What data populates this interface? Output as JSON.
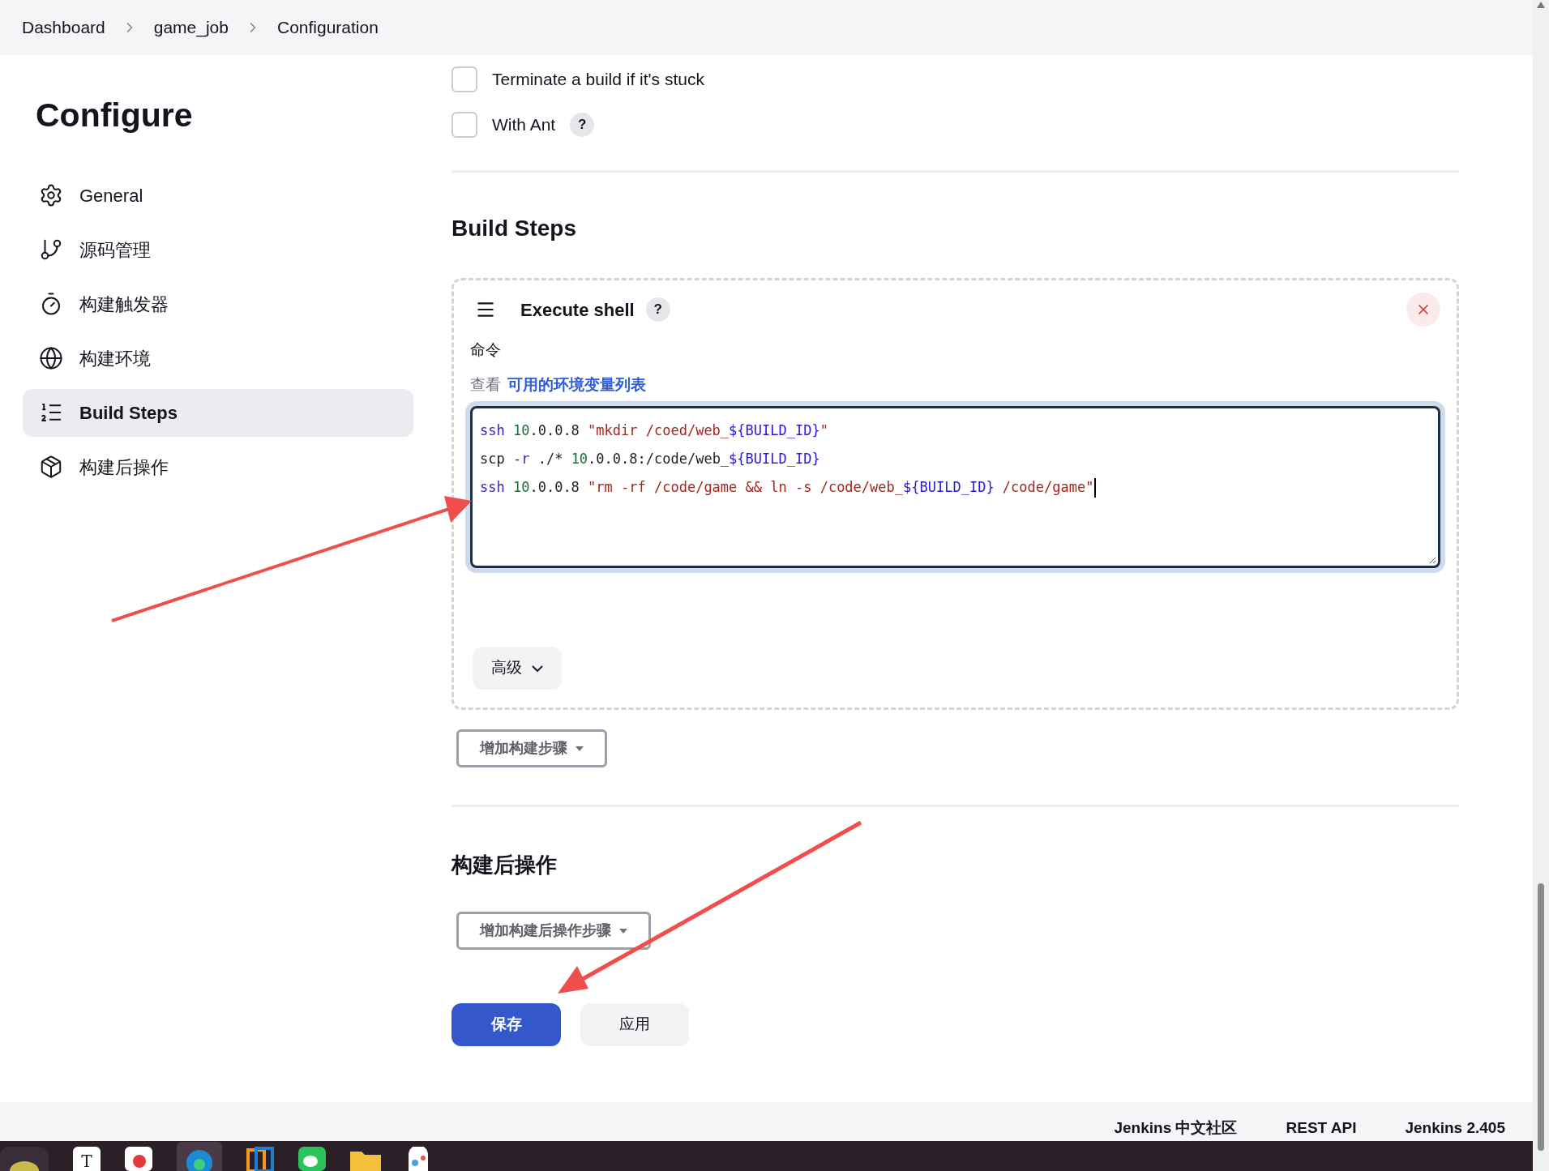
{
  "breadcrumbs": [
    "Dashboard",
    "game_job",
    "Configuration"
  ],
  "sidebar": {
    "title": "Configure",
    "items": [
      {
        "label": "General",
        "selected": false
      },
      {
        "label": "源码管理",
        "selected": false
      },
      {
        "label": "构建触发器",
        "selected": false
      },
      {
        "label": "构建环境",
        "selected": false
      },
      {
        "label": "Build Steps",
        "selected": true
      },
      {
        "label": "构建后操作",
        "selected": false
      }
    ]
  },
  "options": [
    {
      "label": "Terminate a build if it's stuck",
      "checked": false
    },
    {
      "label": "With Ant",
      "checked": false,
      "help": "?"
    }
  ],
  "build_steps": {
    "heading": "Build Steps",
    "step": {
      "title": "Execute shell",
      "help": "?",
      "field_label": "命令",
      "hint_prefix": "查看",
      "hint_link": "可用的环境变量列表",
      "lines": [
        [
          {
            "kind": "keyword",
            "text": "ssh "
          },
          {
            "kind": "number",
            "text": "10"
          },
          {
            "kind": "plain",
            "text": ".0.0.8 "
          },
          {
            "kind": "string",
            "text": "\"mkdir /coed/web_"
          },
          {
            "kind": "var",
            "text": "${BUILD_ID}"
          },
          {
            "kind": "string",
            "text": "\""
          }
        ],
        [
          {
            "kind": "plain",
            "text": "scp "
          },
          {
            "kind": "keyword",
            "text": "-r"
          },
          {
            "kind": "plain",
            "text": " ./* "
          },
          {
            "kind": "number",
            "text": "10"
          },
          {
            "kind": "plain",
            "text": ".0.0.8:/code/web_"
          },
          {
            "kind": "var",
            "text": "${BUILD_ID}"
          }
        ],
        [
          {
            "kind": "keyword",
            "text": "ssh "
          },
          {
            "kind": "number",
            "text": "10"
          },
          {
            "kind": "plain",
            "text": ".0.0.8 "
          },
          {
            "kind": "string",
            "text": "\"rm -rf /code/game && ln -s /code/web_"
          },
          {
            "kind": "var",
            "text": "${BUILD_ID}"
          },
          {
            "kind": "string",
            "text": " /code/game\""
          }
        ]
      ],
      "advanced": "高级"
    },
    "add_button": "增加构建步骤"
  },
  "post_build": {
    "heading": "构建后操作",
    "add_button": "增加构建后操作步骤"
  },
  "actions": {
    "save": "保存",
    "apply": "应用"
  },
  "footer": [
    "Jenkins 中文社区",
    "REST API",
    "Jenkins 2.405"
  ],
  "taskbar": [
    {
      "kind": "round"
    },
    {
      "kind": "letter",
      "label": "T"
    },
    {
      "kind": "red"
    },
    {
      "kind": "edge",
      "selected": true
    },
    {
      "kind": "vm"
    },
    {
      "kind": "chat"
    },
    {
      "kind": "folder"
    },
    {
      "kind": "paint"
    }
  ]
}
